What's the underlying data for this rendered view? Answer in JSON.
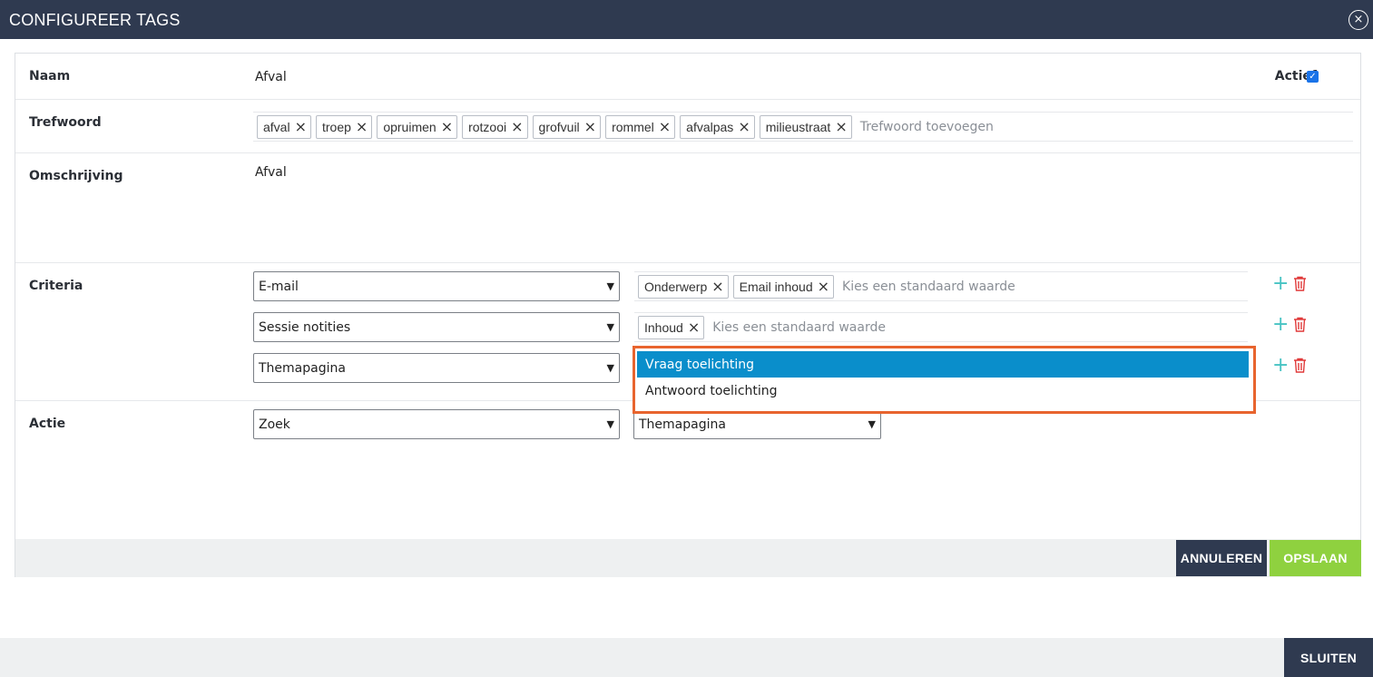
{
  "dialog": {
    "title": "CONFIGUREER TAGS",
    "close_icon": "×"
  },
  "naam": {
    "label": "Naam",
    "value": "Afval",
    "actief_label": "Actief",
    "actief_checked": true
  },
  "trefwoord": {
    "label": "Trefwoord",
    "tags": [
      "afval",
      "troep",
      "opruimen",
      "rotzooi",
      "grofvuil",
      "rommel",
      "afvalpas",
      "milieustraat"
    ],
    "placeholder": "Trefwoord toevoegen"
  },
  "omschrijving": {
    "label": "Omschrijving",
    "value": "Afval"
  },
  "criteria": {
    "label": "Criteria",
    "rows": [
      {
        "select": "E-mail",
        "tags": [
          "Onderwerp",
          "Email inhoud"
        ],
        "placeholder": "Kies een standaard waarde"
      },
      {
        "select": "Sessie notities",
        "tags": [
          "Inhoud"
        ],
        "placeholder": "Kies een standaard waarde"
      },
      {
        "select": "Themapagina",
        "tags": [],
        "placeholder": ""
      }
    ],
    "dropdown_options": [
      "Vraag toelichting",
      "Antwoord toelichting"
    ],
    "dropdown_highlight_color": "#0a8ecb",
    "dropdown_border_color": "#e8642e"
  },
  "actie": {
    "label": "Actie",
    "select1": "Zoek",
    "select2": "Themapagina"
  },
  "buttons": {
    "cancel": "ANNULEREN",
    "save": "OPSLAAN",
    "close": "SLUITEN"
  },
  "colors": {
    "header": "#2f3a50",
    "save": "#8fd13f",
    "plus": "#47c3c3",
    "trash": "#e03a3a"
  }
}
